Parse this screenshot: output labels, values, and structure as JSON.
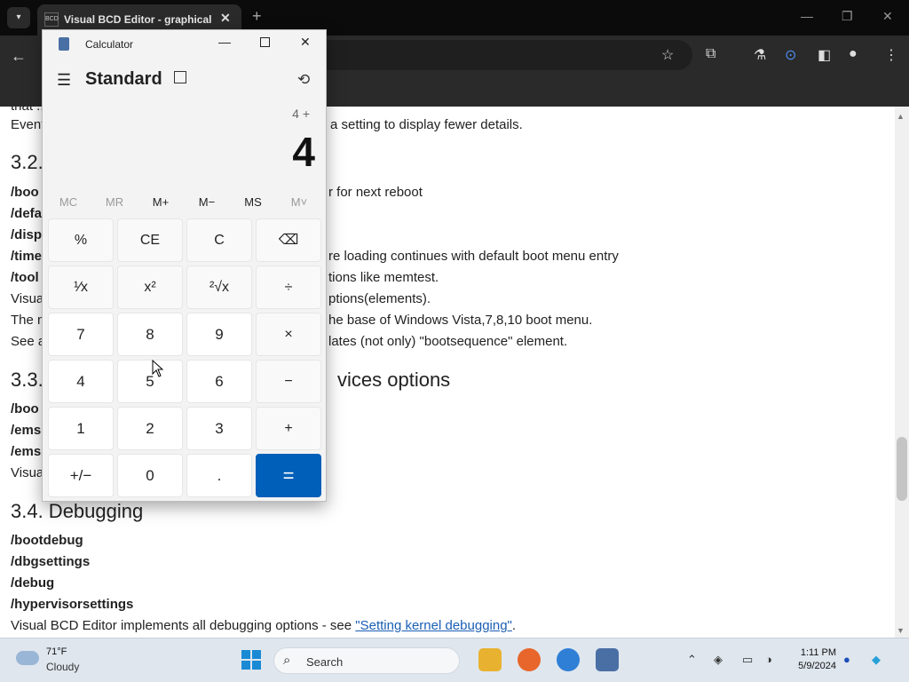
{
  "browser": {
    "tab_title": "Visual BCD Editor - graphical b",
    "tab_favicon": "BCD",
    "tab_close": "✕",
    "new_tab": "+",
    "win_min": "—",
    "win_max": "❐",
    "win_close": "✕",
    "back": "←"
  },
  "page": {
    "lines": [
      {
        "text": "that ...",
        "bold": false
      },
      {
        "text": "Event",
        "bold": false
      },
      {
        "text": "a setting to display fewer details.",
        "bold": false
      },
      {
        "text": "3.2.",
        "bold": false
      },
      {
        "text": "/boo",
        "bold": true
      },
      {
        "text": "r for next reboot",
        "bold": false
      },
      {
        "text": "/defa",
        "bold": true
      },
      {
        "text": "/disp",
        "bold": true
      },
      {
        "text": "/time",
        "bold": true
      },
      {
        "text": "re loading continues with default boot menu entry",
        "bold": false
      },
      {
        "text": "/tool",
        "bold": true
      },
      {
        "text": "tions like memtest.",
        "bold": false
      },
      {
        "text": "Visua",
        "bold": false
      },
      {
        "text": "ptions(elements).",
        "bold": false
      },
      {
        "text": "The n",
        "bold": false
      },
      {
        "text": "he base of Windows Vista,7,8,10 boot menu.",
        "bold": false
      },
      {
        "text": "See a",
        "bold": false
      },
      {
        "text": "lates (not only) \"bootsequence\" element.",
        "bold": false
      },
      {
        "text": "3.3.",
        "bold": false
      },
      {
        "text": "vices options",
        "bold": false
      },
      {
        "text": "/boo",
        "bold": true
      },
      {
        "text": "/ems",
        "bold": true
      },
      {
        "text": "/ems",
        "bold": true
      },
      {
        "text": "Visua",
        "bold": false
      }
    ],
    "heading_debugging": "3.4. Debugging",
    "debug_options": [
      "/bootdebug",
      "/dbgsettings",
      "/debug",
      "/hypervisorsettings"
    ],
    "footer_text": "Visual BCD Editor implements all debugging options - see ",
    "footer_link": "\"Setting kernel debugging\"",
    "footer_end": "."
  },
  "calculator": {
    "app_title": "Calculator",
    "mode": "Standard",
    "expression": "4 +",
    "display": "4",
    "memory": [
      "MC",
      "MR",
      "M+",
      "M−",
      "MS",
      "M˅"
    ],
    "memory_enabled": [
      false,
      false,
      true,
      true,
      true,
      false
    ],
    "keys": [
      [
        "%",
        "CE",
        "C",
        "⌫"
      ],
      [
        "¹⁄x",
        "x²",
        "²√x",
        "÷"
      ],
      [
        "7",
        "8",
        "9",
        "×"
      ],
      [
        "4",
        "5",
        "6",
        "−"
      ],
      [
        "1",
        "2",
        "3",
        "+"
      ],
      [
        "+/−",
        "0",
        ".",
        "="
      ]
    ]
  },
  "taskbar": {
    "temperature": "71°F",
    "condition": "Cloudy",
    "search_label": "Search",
    "time": "1:11 PM",
    "date": "5/9/2024"
  },
  "colors": {
    "accent": "#005fb8",
    "link": "#1a5fb4",
    "page_bg": "#ffffff",
    "chrome_bg": "#2a2a2a"
  }
}
